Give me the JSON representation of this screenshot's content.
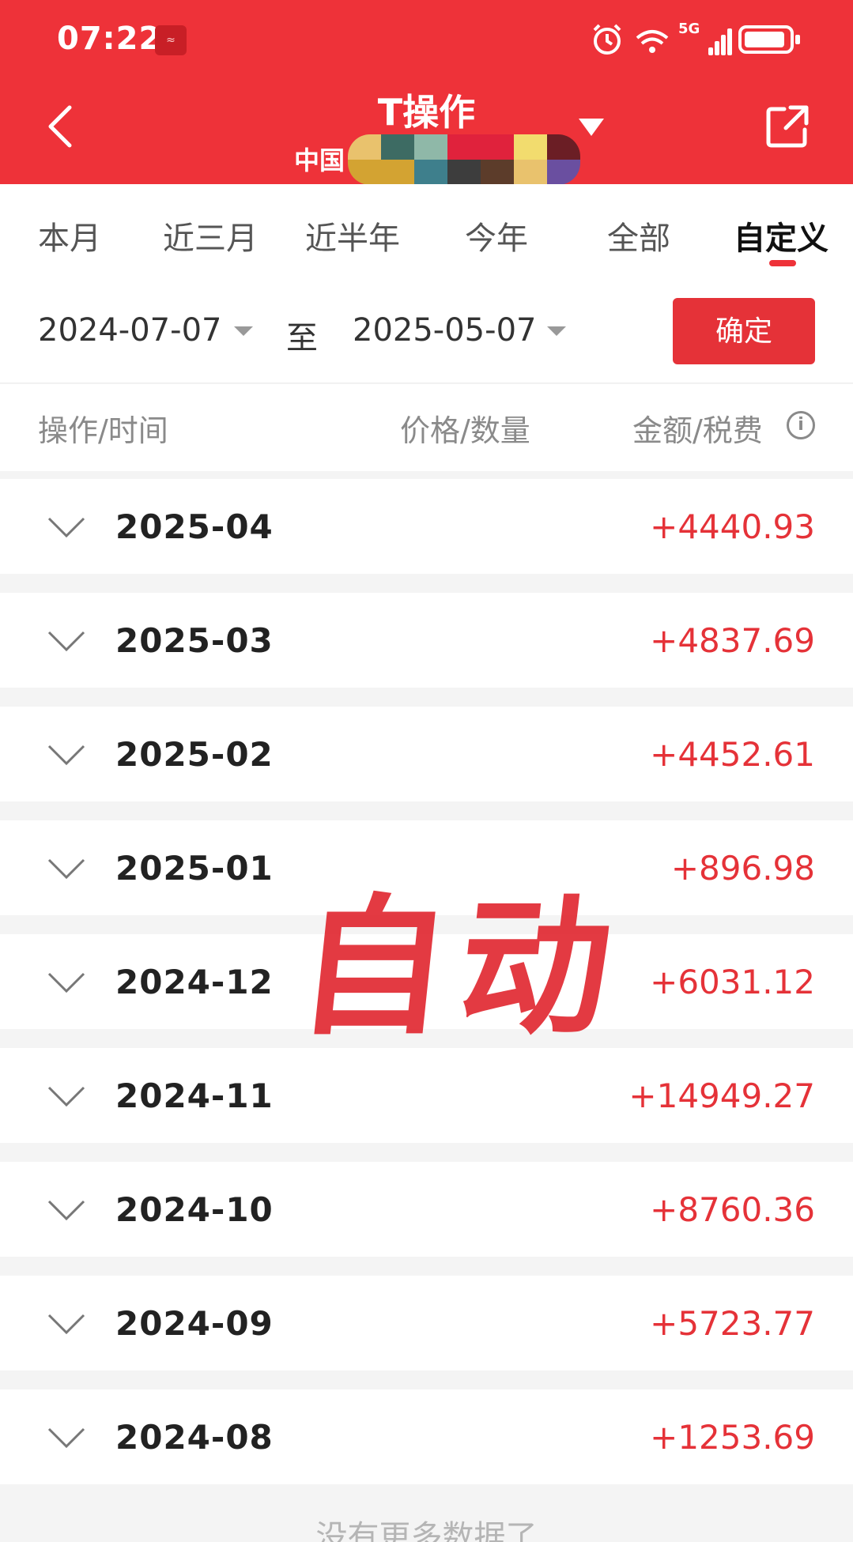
{
  "status_bar": {
    "time": "07:22",
    "network": "5G"
  },
  "header": {
    "title": "T操作",
    "subtitle": "中国",
    "mosaic_colors": [
      "#e9c26d",
      "#3d6b63",
      "#8fb8a8",
      "#e0223c",
      "#e0223c",
      "#f2dc6e",
      "#6b1e25",
      "#d3a332",
      "#d3a332",
      "#3e7f8c",
      "#3d3d3d",
      "#5c3c2a",
      "#e9c26d",
      "#6a4fa0",
      "#2a2a2a",
      "#d8b040",
      "#e9c26d"
    ]
  },
  "tabs": [
    {
      "label": "本月",
      "active": false
    },
    {
      "label": "近三月",
      "active": false
    },
    {
      "label": "近半年",
      "active": false
    },
    {
      "label": "今年",
      "active": false
    },
    {
      "label": "全部",
      "active": false
    },
    {
      "label": "自定义",
      "active": true
    }
  ],
  "date_range": {
    "start": "2024-07-07",
    "separator": "至",
    "end": "2025-05-07",
    "confirm_label": "确定"
  },
  "columns": {
    "op_time": "操作/时间",
    "price_qty": "价格/数量",
    "amount_tax": "金额/税费"
  },
  "rows": [
    {
      "month": "2025-04",
      "amount": "+4440.93"
    },
    {
      "month": "2025-03",
      "amount": "+4837.69"
    },
    {
      "month": "2025-02",
      "amount": "+4452.61"
    },
    {
      "month": "2025-01",
      "amount": "+896.98"
    },
    {
      "month": "2024-12",
      "amount": "+6031.12"
    },
    {
      "month": "2024-11",
      "amount": "+14949.27"
    },
    {
      "month": "2024-10",
      "amount": "+8760.36"
    },
    {
      "month": "2024-09",
      "amount": "+5723.77"
    },
    {
      "month": "2024-08",
      "amount": "+1253.69"
    }
  ],
  "footer": {
    "no_more": "没有更多数据了"
  },
  "watermark": "自动",
  "colors": {
    "brand_red": "#ee3239",
    "amount_red": "#e53238"
  }
}
